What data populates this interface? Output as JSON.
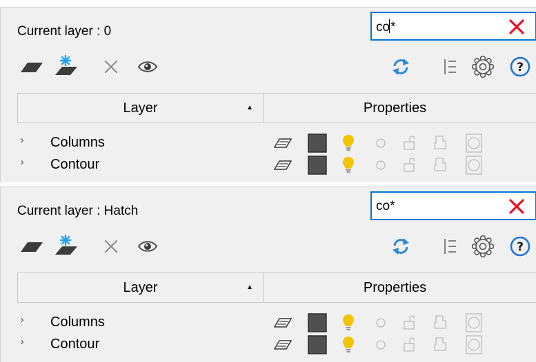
{
  "panels": [
    {
      "current_layer_label": "Current layer : 0",
      "search": {
        "value_before_caret": "co",
        "value_after_caret": "*",
        "caret_visible": true
      },
      "columns": {
        "layer": "Layer",
        "properties": "Properties"
      },
      "rows": [
        {
          "name": "Columns",
          "color": "#505050"
        },
        {
          "name": "Contour",
          "color": "#505050"
        }
      ]
    },
    {
      "current_layer_label": "Current layer : Hatch",
      "search": {
        "value_before_caret": "co*",
        "value_after_caret": "",
        "caret_visible": false
      },
      "columns": {
        "layer": "Layer",
        "properties": "Properties"
      },
      "rows": [
        {
          "name": "Columns",
          "color": "#505050"
        },
        {
          "name": "Contour",
          "color": "#505050"
        }
      ]
    }
  ],
  "toolbar_icons": [
    "new-layer-icon",
    "new-layer-vp-frozen-icon",
    "delete-layer-icon",
    "eye-icon",
    "refresh-icon",
    "layer-list-icon",
    "settings-icon",
    "help-icon"
  ],
  "row_icons": [
    "current-layer-icon",
    "color-swatch",
    "light-bulb-icon",
    "freeze-icon",
    "lock-icon",
    "plot-icon",
    "transparency-icon"
  ],
  "colors": {
    "accent": "#0078d7",
    "clear_x": "#e81123",
    "bulb_on": "#f5c400",
    "refresh": "#2a8ad8",
    "help": "#1e6fd9",
    "new_layer_star": "#1da1f2",
    "layer_swatch": "#505050"
  }
}
